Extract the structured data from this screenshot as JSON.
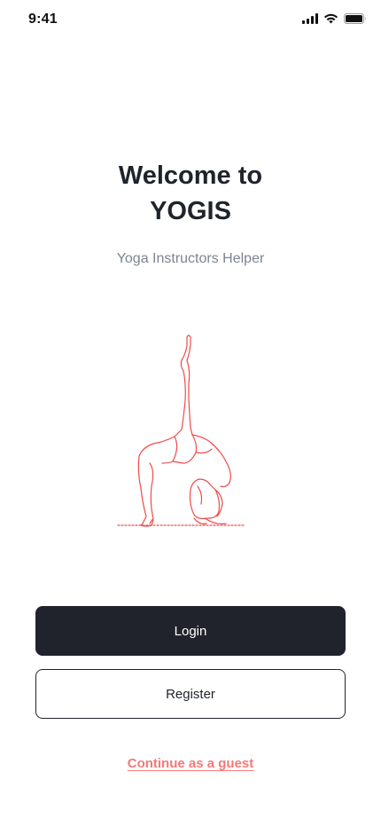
{
  "status_bar": {
    "time": "9:41",
    "icons": [
      "cellular-signal-icon",
      "wifi-icon",
      "battery-icon"
    ]
  },
  "welcome": {
    "title_line1": "Welcome to",
    "title_line2": "YOGIS",
    "subtitle": "Yoga Instructors Helper"
  },
  "illustration": {
    "name": "yoga-pose-illustration",
    "stroke_color": "#f04a4a"
  },
  "actions": {
    "login_label": "Login",
    "register_label": "Register",
    "guest_label": "Continue as a guest"
  },
  "colors": {
    "primary_dark": "#20232b",
    "accent": "#f47979",
    "subtitle": "#7c8591"
  }
}
